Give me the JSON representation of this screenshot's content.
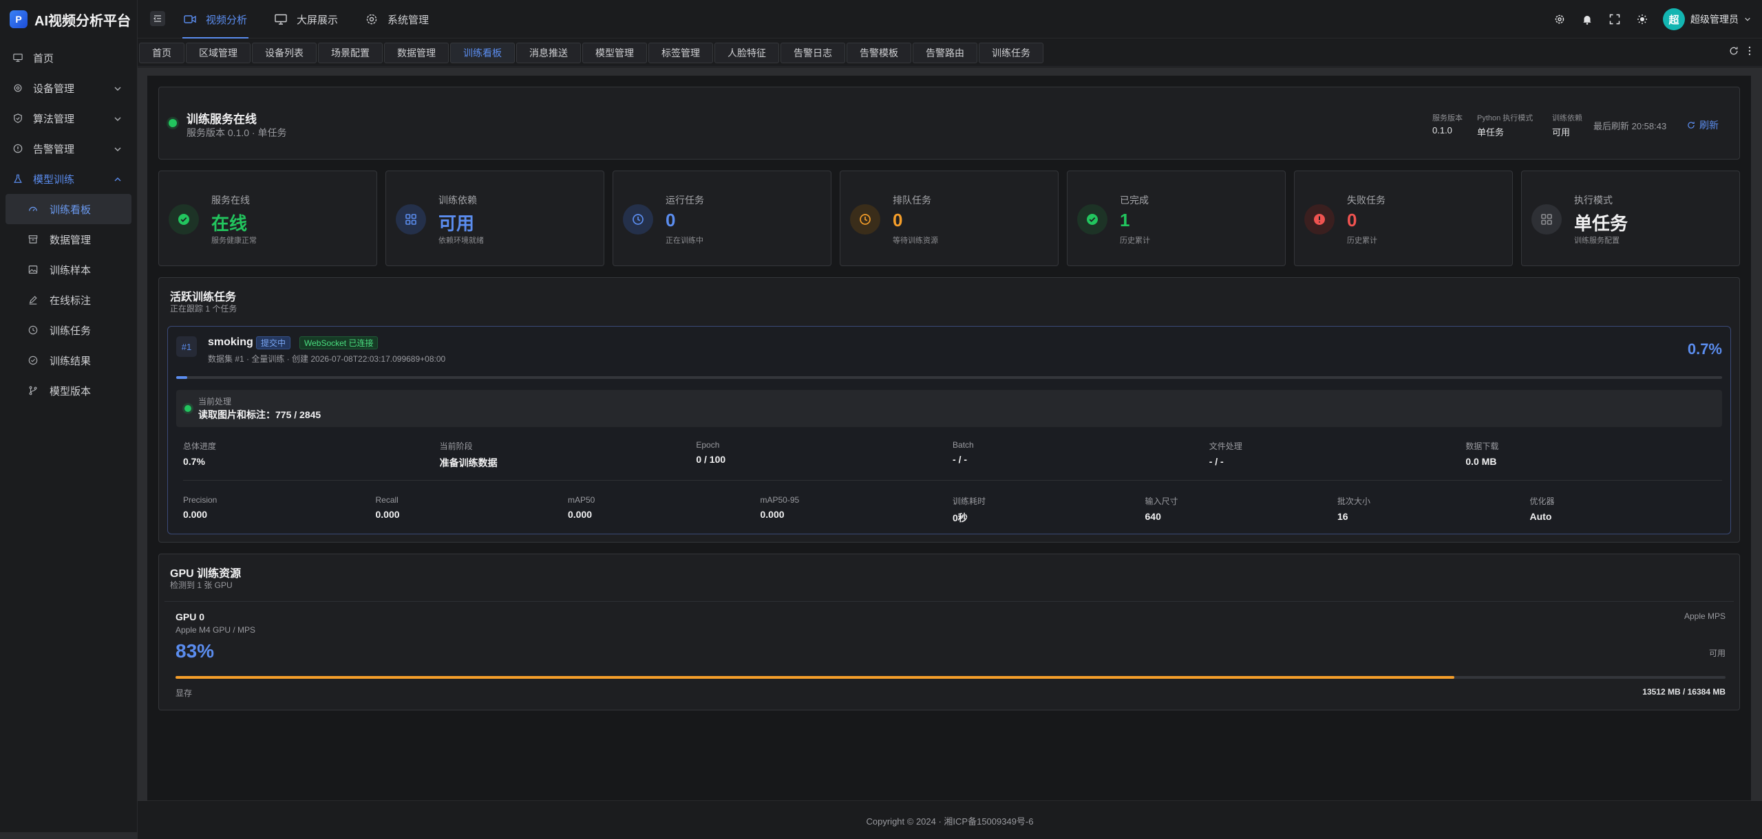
{
  "app": {
    "title": "AI视频分析平台",
    "logo_letter": "P"
  },
  "sidebar": {
    "items": [
      {
        "label": "首页",
        "icon": "monitor-icon"
      },
      {
        "label": "设备管理",
        "icon": "gear-icon",
        "expandable": true
      },
      {
        "label": "算法管理",
        "icon": "shield-icon",
        "expandable": true
      },
      {
        "label": "告警管理",
        "icon": "alert-circle-icon",
        "expandable": true
      },
      {
        "label": "模型训练",
        "icon": "flask-icon",
        "expandable": true,
        "expanded": true
      }
    ],
    "subitems": [
      {
        "label": "训练看板",
        "icon": "dashboard-icon",
        "active": true
      },
      {
        "label": "数据管理",
        "icon": "archive-icon"
      },
      {
        "label": "训练样本",
        "icon": "image-icon"
      },
      {
        "label": "在线标注",
        "icon": "pencil-icon"
      },
      {
        "label": "训练任务",
        "icon": "clock-icon"
      },
      {
        "label": "训练结果",
        "icon": "check-circle-icon"
      },
      {
        "label": "模型版本",
        "icon": "git-branch-icon"
      }
    ]
  },
  "header": {
    "nav": [
      {
        "label": "视频分析",
        "icon": "video-icon",
        "active": true
      },
      {
        "label": "大屏展示",
        "icon": "monitor-icon"
      },
      {
        "label": "系统管理",
        "icon": "gear-icon"
      }
    ],
    "user": {
      "avatar_text": "超",
      "name": "超级管理员"
    }
  },
  "tabs": [
    "首页",
    "区域管理",
    "设备列表",
    "场景配置",
    "数据管理",
    "训练看板",
    "消息推送",
    "模型管理",
    "标签管理",
    "人脸特征",
    "告警日志",
    "告警模板",
    "告警路由",
    "训练任务"
  ],
  "active_tab": "训练看板",
  "status": {
    "title": "训练服务在线",
    "subtitle": "服务版本 0.1.0 · 单任务",
    "meta": [
      {
        "label": "服务版本",
        "value": "0.1.0"
      },
      {
        "label": "Python 执行模式",
        "value": "单任务"
      },
      {
        "label": "训练依赖",
        "value": "可用"
      }
    ],
    "last_refresh": "最后刷新 20:58:43",
    "refresh_label": "刷新"
  },
  "stats": [
    {
      "label": "服务在线",
      "value": "在线",
      "desc": "服务健康正常",
      "color": "#22c55e",
      "bg": "#1d3326",
      "icon": "check-circle-icon"
    },
    {
      "label": "训练依赖",
      "value": "可用",
      "desc": "依赖环境就绪",
      "color": "#5b8def",
      "bg": "#24304a",
      "icon": "grid-icon"
    },
    {
      "label": "运行任务",
      "value": "0",
      "desc": "正在训练中",
      "color": "#5b8def",
      "bg": "#24304a",
      "icon": "clock-icon"
    },
    {
      "label": "排队任务",
      "value": "0",
      "desc": "等待训练资源",
      "color": "#f59e2a",
      "bg": "#3a2d1a",
      "icon": "clock-icon"
    },
    {
      "label": "已完成",
      "value": "1",
      "desc": "历史累计",
      "color": "#22c55e",
      "bg": "#1d3326",
      "icon": "check-circle-icon"
    },
    {
      "label": "失败任务",
      "value": "0",
      "desc": "历史累计",
      "color": "#ef5350",
      "bg": "#3a1f1f",
      "icon": "alert-circle-icon"
    },
    {
      "label": "执行模式",
      "value": "单任务",
      "desc": "训练服务配置",
      "color": "#f1f1f2",
      "bg": "#2e3035",
      "icon": "grid-icon"
    }
  ],
  "active": {
    "title": "活跃训练任务",
    "subtitle": "正在跟踪 1 个任务",
    "task": {
      "num": "#1",
      "name": "smoking",
      "status_pill": "提交中",
      "ws_pill": "WebSocket 已连接",
      "meta": "数据集 #1 · 全量训练 · 创建 2026-07-08T22:03:17.099689+08:00",
      "progress_text": "0.7%",
      "progress": 0.007,
      "current_label": "当前处理",
      "current_value": "读取图片和标注：775 / 2845",
      "metrics1": [
        {
          "label": "总体进度",
          "value": "0.7%"
        },
        {
          "label": "当前阶段",
          "value": "准备训练数据"
        },
        {
          "label": "Epoch",
          "value": "0 / 100"
        },
        {
          "label": "Batch",
          "value": "- / -"
        },
        {
          "label": "文件处理",
          "value": "- / -"
        },
        {
          "label": "数据下载",
          "value": "0.0 MB"
        }
      ],
      "metrics2": [
        {
          "label": "Precision",
          "value": "0.000"
        },
        {
          "label": "Recall",
          "value": "0.000"
        },
        {
          "label": "mAP50",
          "value": "0.000"
        },
        {
          "label": "mAP50-95",
          "value": "0.000"
        },
        {
          "label": "训练耗时",
          "value": "0秒"
        },
        {
          "label": "输入尺寸",
          "value": "640"
        },
        {
          "label": "批次大小",
          "value": "16"
        },
        {
          "label": "优化器",
          "value": "Auto"
        }
      ]
    }
  },
  "gpu": {
    "title": "GPU 训练资源",
    "subtitle": "检测到 1 张 GPU",
    "name": "GPU 0",
    "model": "Apple M4 GPU / MPS",
    "tag": "Apple MPS",
    "percent_text": "83%",
    "percent": 0.825,
    "availability": "可用",
    "mem_label": "显存",
    "mem_value": "13512 MB / 16384 MB"
  },
  "footer": "Copyright © 2024 · 湘ICP备15009349号-6"
}
